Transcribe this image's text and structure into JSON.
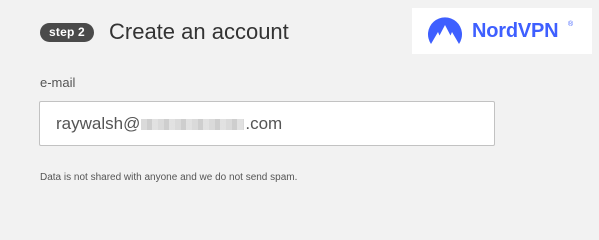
{
  "header": {
    "step_badge": "step 2",
    "title": "Create an account"
  },
  "logo": {
    "icon": "nordvpn-mountain-icon",
    "text": "NordVPN",
    "registered_mark": "®",
    "color": "#3e5fff"
  },
  "email": {
    "label": "e-mail",
    "value_prefix": "raywalsh@",
    "value_suffix": ".com"
  },
  "helper_text": "Data is not shared with anyone and we do not send spam.",
  "colors": {
    "background": "#f2f2f2",
    "badge": "#4a4a4a",
    "brand": "#3e5fff"
  }
}
